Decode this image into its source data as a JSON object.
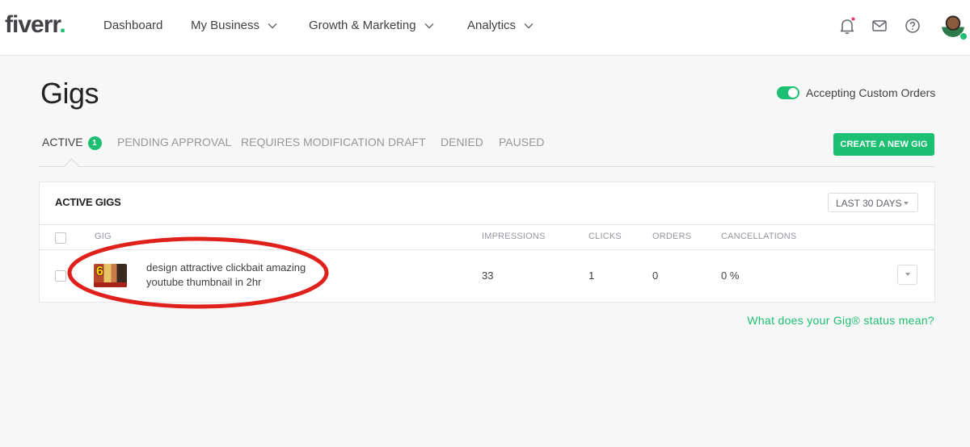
{
  "brand": {
    "logo_text": "fiverr",
    "logo_dot": ".",
    "accent": "#1dbf73",
    "notification_dot": "#e4346e"
  },
  "nav": {
    "items": [
      {
        "label": "Dashboard"
      },
      {
        "label": "My Business"
      },
      {
        "label": "Growth & Marketing"
      },
      {
        "label": "Analytics"
      }
    ],
    "icons": [
      "bell-icon",
      "envelope-icon",
      "help-icon",
      "avatar"
    ]
  },
  "page": {
    "title": "Gigs",
    "toggle_label": "Accepting Custom Orders",
    "toggle_on": true
  },
  "tabs": [
    {
      "label": "ACTIVE",
      "badge": "1",
      "active": true
    },
    {
      "label": "PENDING APPROVAL"
    },
    {
      "label": "REQUIRES MODIFICATION"
    },
    {
      "label": "DRAFT"
    },
    {
      "label": "DENIED"
    },
    {
      "label": "PAUSED"
    }
  ],
  "create_button": "CREATE A NEW GIG",
  "table": {
    "title": "ACTIVE GIGS",
    "range": "LAST 30 DAYS",
    "columns": [
      "GIG",
      "IMPRESSIONS",
      "CLICKS",
      "ORDERS",
      "CANCELLATIONS"
    ],
    "rows": [
      {
        "thumb_text": "6",
        "title": "design attractive clickbait amazing youtube thumbnail in 2hr",
        "impressions": "33",
        "clicks": "1",
        "orders": "0",
        "cancellations": "0 %"
      }
    ]
  },
  "help_link": "What does your Gig® status mean?"
}
